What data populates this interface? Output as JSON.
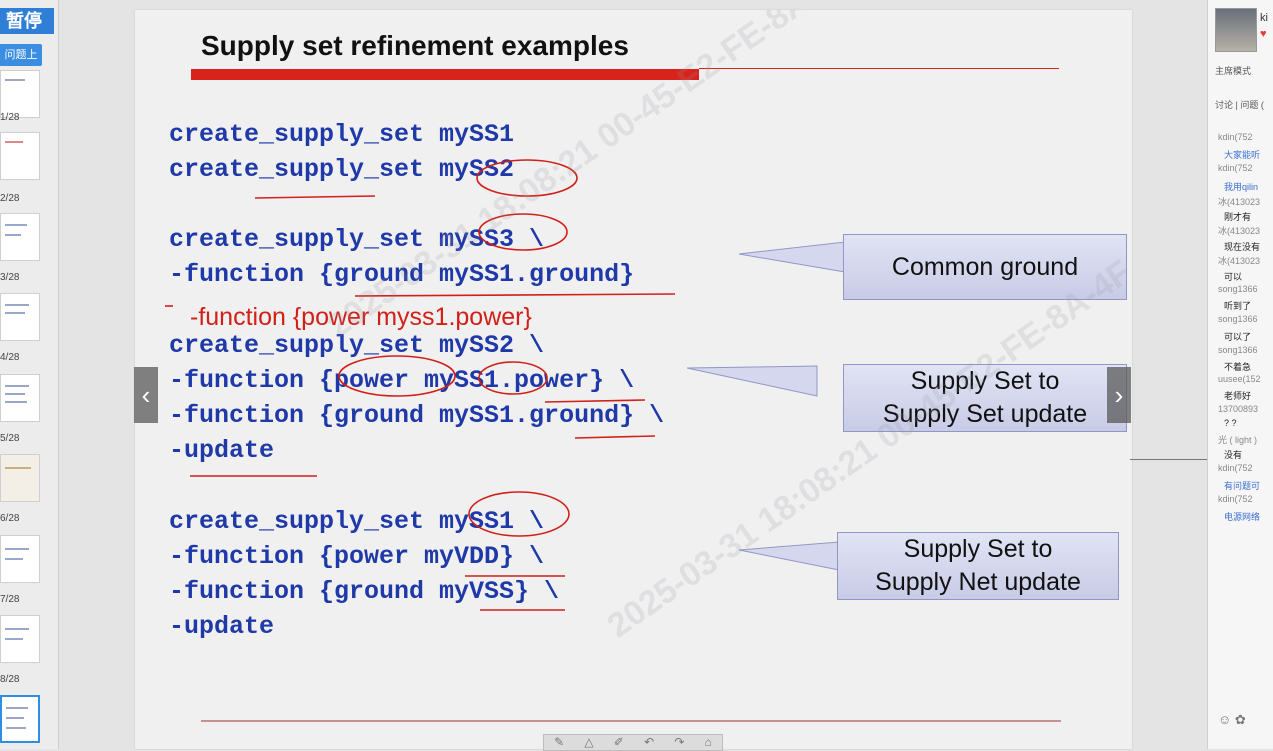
{
  "sidebar": {
    "pause_label": "暂停",
    "upload_label": "问题上传",
    "pages": [
      "1/28",
      "2/28",
      "3/28",
      "4/28",
      "5/28",
      "6/28",
      "7/28",
      "8/28"
    ]
  },
  "slide": {
    "title": "Supply set refinement examples",
    "code_block_1": "create_supply_set mySS1\ncreate_supply_set mySS2",
    "code_block_2": "create_supply_set mySS3 \\\n-function {ground mySS1.ground}",
    "annotation": "-function {power myss1.power}",
    "code_block_3": "create_supply_set mySS2 \\\n-function {power mySS1.power} \\\n-function {ground mySS1.ground} \\\n-update",
    "code_block_4": "create_supply_set mySS1 \\\n-function {power myVDD} \\\n-function {ground myVSS} \\\n-update",
    "callout_1": "Common ground",
    "callout_2_line1": "Supply Set to",
    "callout_2_line2": "Supply Set update",
    "callout_3_line1": "Supply Set to",
    "callout_3_line2": "Supply Net update",
    "prev_arrow": "‹",
    "next_arrow": "›"
  },
  "chat": {
    "user_initial": "ki",
    "mode_label": "主席模式",
    "tabs_label": "讨论 | 问题 (",
    "messages": [
      {
        "name": "kdin(752",
        "text": "大家能听"
      },
      {
        "name": "kdin(752",
        "text": "我用qilin"
      },
      {
        "name": "冰(413023",
        "text": "刚才有"
      },
      {
        "name": "冰(413023",
        "text": "现在没有"
      },
      {
        "name": "冰(413023",
        "text": "可以"
      },
      {
        "name": "song1366",
        "text": "听到了"
      },
      {
        "name": "song1366",
        "text": "可以了"
      },
      {
        "name": "song1366",
        "text": "不着急"
      },
      {
        "name": "uusee(152",
        "text": "老师好"
      },
      {
        "name": "13700893",
        "text": "? ?"
      },
      {
        "name": "光 ( light )",
        "text": "没有"
      },
      {
        "name": "kdin(752",
        "text": "有问题可"
      },
      {
        "name": "kdin(752",
        "text": "电源网络"
      }
    ]
  },
  "watermark_text": "2025-03-31 18:08:21 00-45-E2-FE-8A-4F",
  "colors": {
    "code": "#1f3aa8",
    "accent_red": "#d8221c",
    "callout_fill": "#d4d7ee",
    "pause_blue": "#2f7fd6"
  },
  "icons": {
    "prev": "chevron-left-icon",
    "next": "chevron-right-icon",
    "like": "heart-icon"
  }
}
